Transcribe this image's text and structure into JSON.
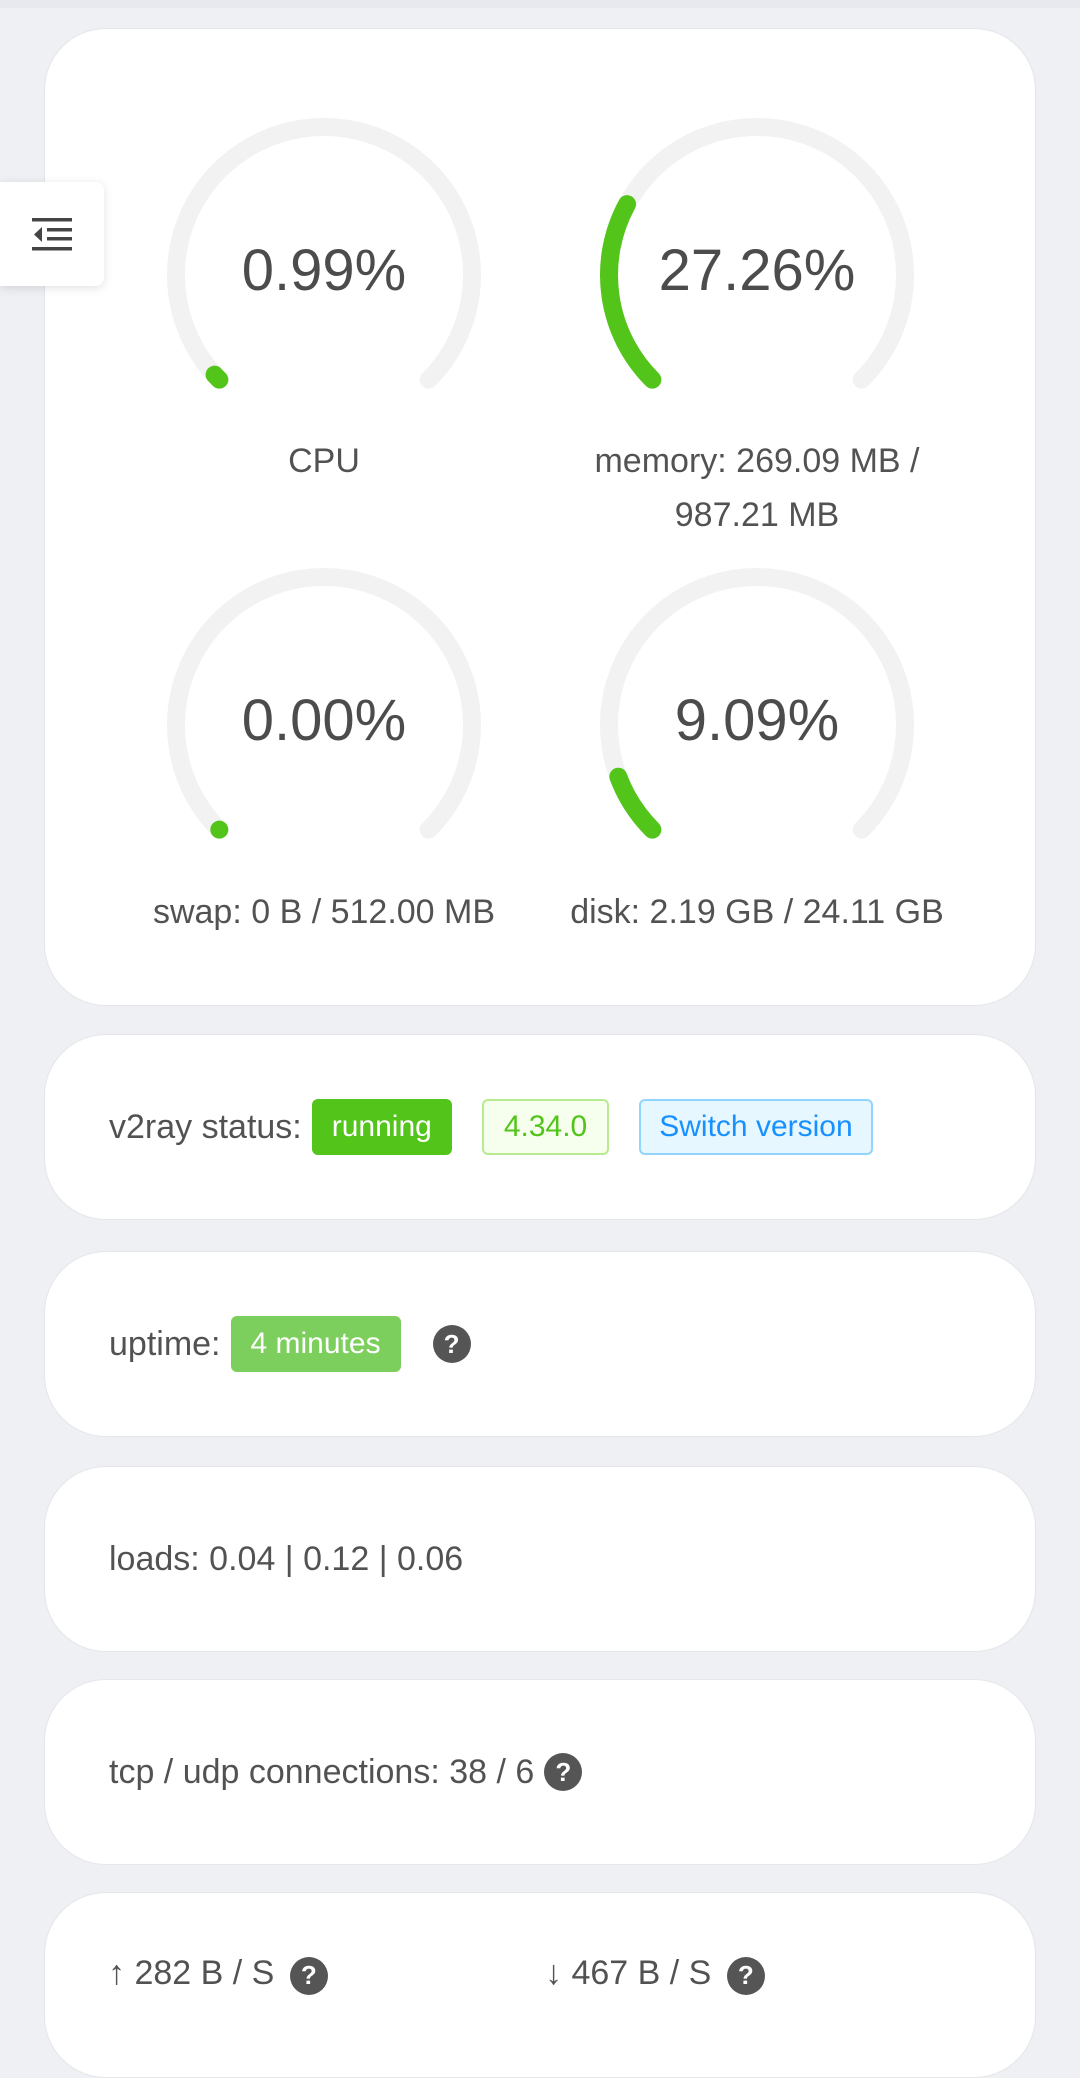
{
  "gauges": [
    {
      "value_text": "0.99%",
      "label": "CPU",
      "percent": 0.99
    },
    {
      "value_text": "27.26%",
      "label_line1": "memory: 269.09 MB /",
      "label_line2": "987.21 MB",
      "percent": 27.26
    },
    {
      "value_text": "0.00%",
      "label": "swap: 0 B / 512.00 MB",
      "percent": 0.0
    },
    {
      "value_text": "9.09%",
      "label": "disk: 2.19 GB / 24.11 GB",
      "percent": 9.09
    }
  ],
  "v2ray": {
    "label": "v2ray status:",
    "status": "running",
    "version": "4.34.0",
    "switch_label": "Switch version"
  },
  "uptime": {
    "label": "uptime:",
    "value": "4 minutes",
    "help": "?"
  },
  "loads": {
    "text": "loads: 0.04 | 0.12 | 0.06"
  },
  "connections": {
    "text": "tcp / udp connections: 38 / 6",
    "help": "?"
  },
  "traffic": {
    "up_text": "↑ 282 B / S",
    "down_text": "↓ 467 B / S",
    "help": "?"
  },
  "colors": {
    "accent": "#52c41a",
    "track": "#f2f2f2",
    "switch_blue": "#1890ff"
  },
  "icons": {
    "menu": "menu-fold-icon",
    "help": "question-circle-icon"
  }
}
